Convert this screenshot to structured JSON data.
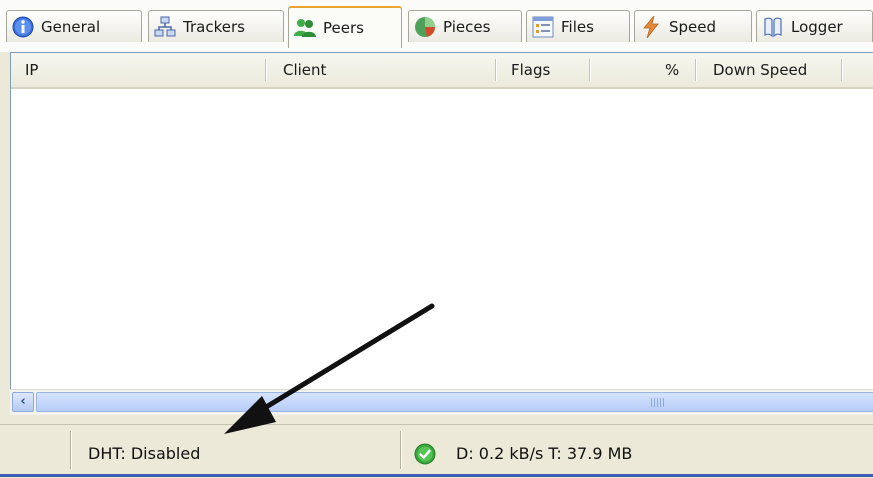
{
  "tabs": [
    {
      "label": "General",
      "icon": "info-icon"
    },
    {
      "label": "Trackers",
      "icon": "network-icon"
    },
    {
      "label": "Peers",
      "icon": "peers-icon",
      "active": true
    },
    {
      "label": "Pieces",
      "icon": "pieces-icon"
    },
    {
      "label": "Files",
      "icon": "files-icon"
    },
    {
      "label": "Speed",
      "icon": "lightning-icon"
    },
    {
      "label": "Logger",
      "icon": "logger-icon"
    }
  ],
  "peers_table": {
    "columns": [
      "IP",
      "Client",
      "Flags",
      "%",
      "Down Speed"
    ],
    "rows": []
  },
  "status_bar": {
    "dht": "DHT: Disabled",
    "transfer": "D: 0.2 kB/s T: 37.9 MB"
  },
  "colors": {
    "active_tab_accent": "#e9a530",
    "scrollbar_blue": "#b7cdf7",
    "status_ok_green": "#3aa53a"
  }
}
